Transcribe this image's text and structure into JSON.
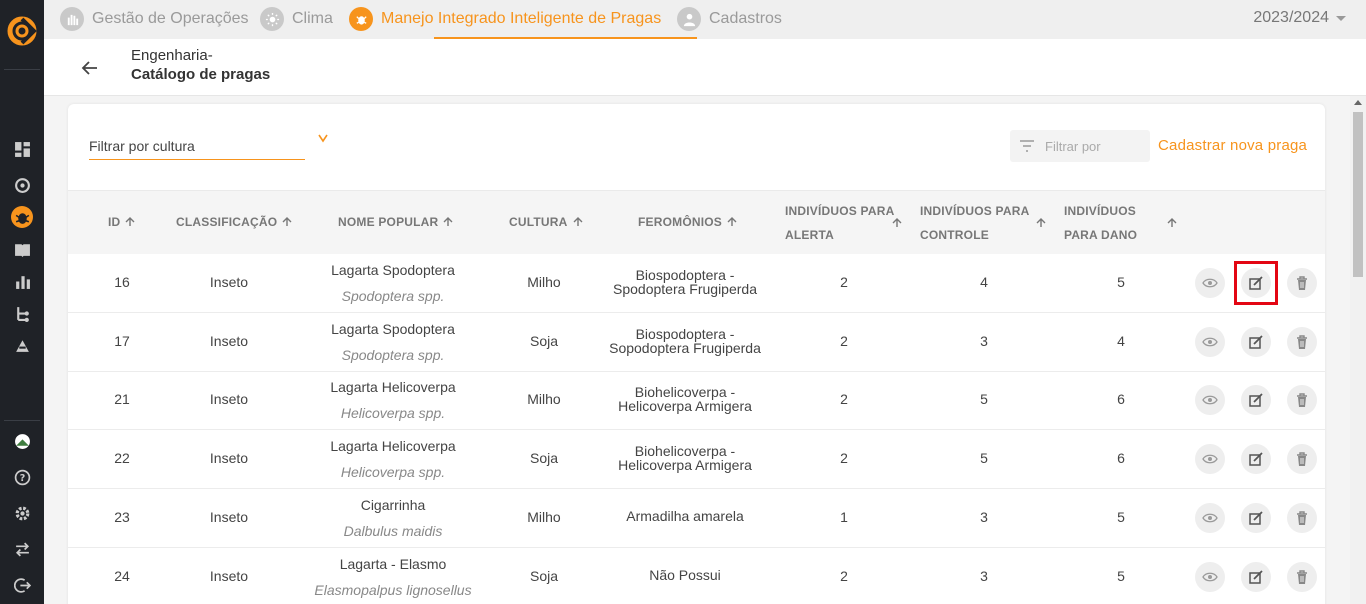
{
  "nav": {
    "tabs": [
      {
        "label": "Gestão de Operações",
        "icon": "hand-icon"
      },
      {
        "label": "Clima",
        "icon": "sun-icon"
      },
      {
        "label": "Manejo Integrado Inteligente de Pragas",
        "icon": "bug-icon"
      },
      {
        "label": "Cadastros",
        "icon": "person-icon"
      }
    ],
    "season": "2023/2024"
  },
  "header": {
    "crumb_parent": "Engenharia-",
    "crumb_title": "Catálogo de pragas"
  },
  "toolbar": {
    "filter_culture_placeholder": "Filtrar por cultura",
    "filter_by_placeholder": "Filtrar por",
    "new_pest_label": "Cadastrar nova praga"
  },
  "table": {
    "columns": {
      "id": "ID",
      "classification": "CLASSIFICAÇÃO",
      "popular_name": "NOME POPULAR",
      "culture": "CULTURA",
      "pheromones": "FEROMÔNIOS",
      "alert_l1": "INDIVÍDUOS PARA",
      "alert_l2": "ALERTA",
      "control_l1": "INDIVÍDUOS PARA",
      "control_l2": "CONTROLE",
      "damage_l1": "INDIVÍDUOS",
      "damage_l2": "PARA DANO"
    },
    "rows": [
      {
        "id": "16",
        "classification": "Inseto",
        "name": "Lagarta Spodoptera",
        "scientific": "Spodoptera spp.",
        "culture": "Milho",
        "pher1": "Biospodoptera -",
        "pher2": "Spodoptera Frugiperda",
        "alert": "2",
        "control": "4",
        "damage": "5"
      },
      {
        "id": "17",
        "classification": "Inseto",
        "name": "Lagarta Spodoptera",
        "scientific": "Spodoptera spp.",
        "culture": "Soja",
        "pher1": "Biospodoptera -",
        "pher2": "Sopodoptera Frugiperda",
        "alert": "2",
        "control": "3",
        "damage": "4"
      },
      {
        "id": "21",
        "classification": "Inseto",
        "name": "Lagarta Helicoverpa",
        "scientific": "Helicoverpa spp.",
        "culture": "Milho",
        "pher1": "Biohelicoverpa -",
        "pher2": "Helicoverpa Armigera",
        "alert": "2",
        "control": "5",
        "damage": "6"
      },
      {
        "id": "22",
        "classification": "Inseto",
        "name": "Lagarta Helicoverpa",
        "scientific": "Helicoverpa spp.",
        "culture": "Soja",
        "pher1": "Biohelicoverpa -",
        "pher2": "Helicoverpa Armigera",
        "alert": "2",
        "control": "5",
        "damage": "6"
      },
      {
        "id": "23",
        "classification": "Inseto",
        "name": "Cigarrinha",
        "scientific": "Dalbulus maidis",
        "culture": "Milho",
        "pher1": "Armadilha amarela",
        "pher2": "",
        "alert": "1",
        "control": "3",
        "damage": "5"
      },
      {
        "id": "24",
        "classification": "Inseto",
        "name": "Lagarta - Elasmo",
        "scientific": "Elasmopalpus lignosellus",
        "culture": "Soja",
        "pher1": "Não Possui",
        "pher2": "",
        "alert": "2",
        "control": "3",
        "damage": "5"
      }
    ]
  },
  "colors": {
    "accent": "#f7941d",
    "rail": "#1f2227",
    "highlight": "#e30613"
  }
}
